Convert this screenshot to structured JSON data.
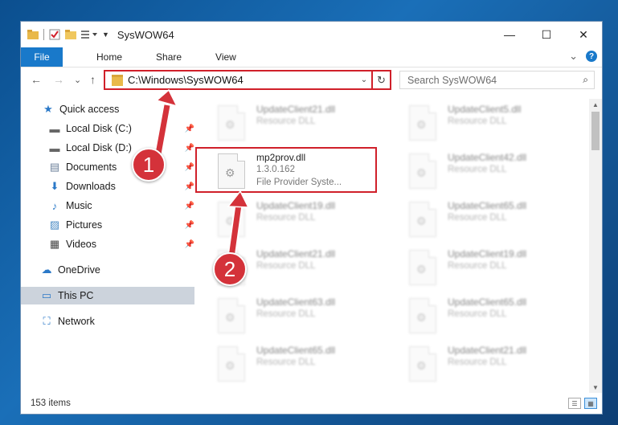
{
  "window": {
    "title": "SysWOW64",
    "controls": {
      "minimize": "—",
      "maximize": "☐",
      "close": "✕"
    }
  },
  "ribbon": {
    "tabs": [
      {
        "label": "File"
      },
      {
        "label": "Home"
      },
      {
        "label": "Share"
      },
      {
        "label": "View"
      }
    ],
    "expand_icon": "⌄",
    "help_icon": "?"
  },
  "navbar": {
    "back": "←",
    "forward": "→",
    "recent": "⌄",
    "up": "↑",
    "address": "C:\\Windows\\SysWOW64",
    "dropdown": "⌄",
    "refresh": "↻",
    "search_placeholder": "Search SysWOW64",
    "search_icon": "⌕"
  },
  "sidebar": {
    "items": [
      {
        "label": "Quick access",
        "icon": "★"
      },
      {
        "label": "Local Disk (C:)",
        "icon": "▬",
        "pin": "📌"
      },
      {
        "label": "Local Disk (D:)",
        "icon": "▬",
        "pin": "📌"
      },
      {
        "label": "Documents",
        "icon": "▤",
        "pin": "📌"
      },
      {
        "label": "Downloads",
        "icon": "⬇",
        "pin": "📌"
      },
      {
        "label": "Music",
        "icon": "♪",
        "pin": "📌"
      },
      {
        "label": "Pictures",
        "icon": "▨",
        "pin": "📌"
      },
      {
        "label": "Videos",
        "icon": "▦",
        "pin": "📌"
      },
      {
        "label": "OneDrive",
        "icon": "☁"
      },
      {
        "label": "This PC",
        "icon": "▭"
      },
      {
        "label": "Network",
        "icon": "⛶"
      }
    ]
  },
  "files": {
    "selected": {
      "name": "mp2prov.dll",
      "version": "1.3.0.162",
      "desc": "File Provider Syste..."
    },
    "col1": [
      {
        "name": "UpdateClient21.dll",
        "desc": "Resource DLL"
      },
      {
        "name": "UpdateClient19.dll",
        "desc": "Resource DLL"
      },
      {
        "name": "UpdateClient21.dll",
        "desc": "Resource DLL"
      },
      {
        "name": "UpdateClient63.dll",
        "desc": "Resource DLL"
      },
      {
        "name": "UpdateClient65.dll",
        "desc": "Resource DLL"
      }
    ],
    "col2": [
      {
        "name": "UpdateClient5.dll",
        "desc": "Resource DLL"
      },
      {
        "name": "UpdateClient42.dll",
        "desc": "Resource DLL"
      },
      {
        "name": "UpdateClient65.dll",
        "desc": "Resource DLL"
      },
      {
        "name": "UpdateClient19.dll",
        "desc": "Resource DLL"
      },
      {
        "name": "UpdateClient65.dll",
        "desc": "Resource DLL"
      },
      {
        "name": "UpdateClient21.dll",
        "desc": "Resource DLL"
      }
    ]
  },
  "scroll": {
    "up": "▲",
    "down": "▼"
  },
  "status": {
    "count": "153 items",
    "details_view": "☰",
    "tiles_view": "▦"
  },
  "annotations": {
    "step1": "1",
    "step2": "2"
  },
  "colors": {
    "accent": "#1979ca",
    "highlight": "#d0202a",
    "badge": "#d4323a"
  }
}
